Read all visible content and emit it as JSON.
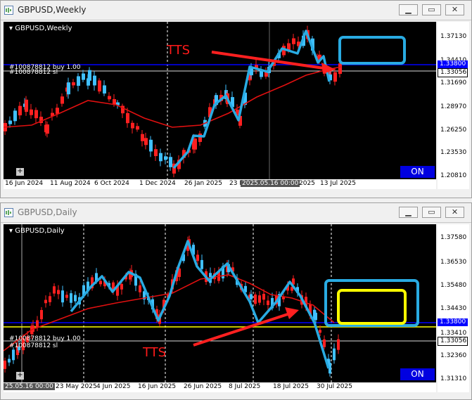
{
  "weekly": {
    "window_title": "GBPUSD,Weekly",
    "symbol_label": "GBPUSD,Weekly",
    "order_buy": "#100878812 buy 1.00",
    "order_sl": "#100878812 sl",
    "annotation": "TTS",
    "status_badge": "ON",
    "price_ticks": [
      "1.37130",
      "1.34410",
      "1.31690",
      "1.28970",
      "1.26250",
      "1.23530",
      "1.20810"
    ],
    "blue_line_price": "1.33800",
    "current_price": "1.33056",
    "time_labels": [
      "16 Jun 2024",
      "11 Aug 2024",
      "6 Oct 2024",
      "1 Dec 2024",
      "26 Jan 2025",
      "23 M",
      "2025.05.16 00:00",
      "2025",
      "13 Jul 2025"
    ]
  },
  "daily": {
    "window_title": "GBPUSD,Daily",
    "symbol_label": "GBPUSD,Daily",
    "order_buy": "#100878812 buy 1.00",
    "order_sl": "#100878812 sl",
    "annotation": "TTS",
    "status_badge": "ON",
    "price_ticks": [
      "1.37580",
      "1.36530",
      "1.35480",
      "1.34430",
      "1.33410",
      "1.32360",
      "1.31310"
    ],
    "blue_line_price": "1.33800",
    "current_price": "1.33056",
    "time_labels": [
      "25.05.16 00:00",
      "23 May 2025",
      "4 Jun 2025",
      "16 Jun 2025",
      "26 Jun 2025",
      "8 Jul 2025",
      "18 Jul 2025",
      "30 Jul 2025"
    ]
  },
  "colors": {
    "accent_cyan": "#29abe2",
    "arrow_red": "#ff2020",
    "ma_red": "#e01010",
    "level_blue": "#0000ff",
    "level_yellow": "#ffff00",
    "bull": "#40c0ff",
    "bear": "#ff2020"
  }
}
